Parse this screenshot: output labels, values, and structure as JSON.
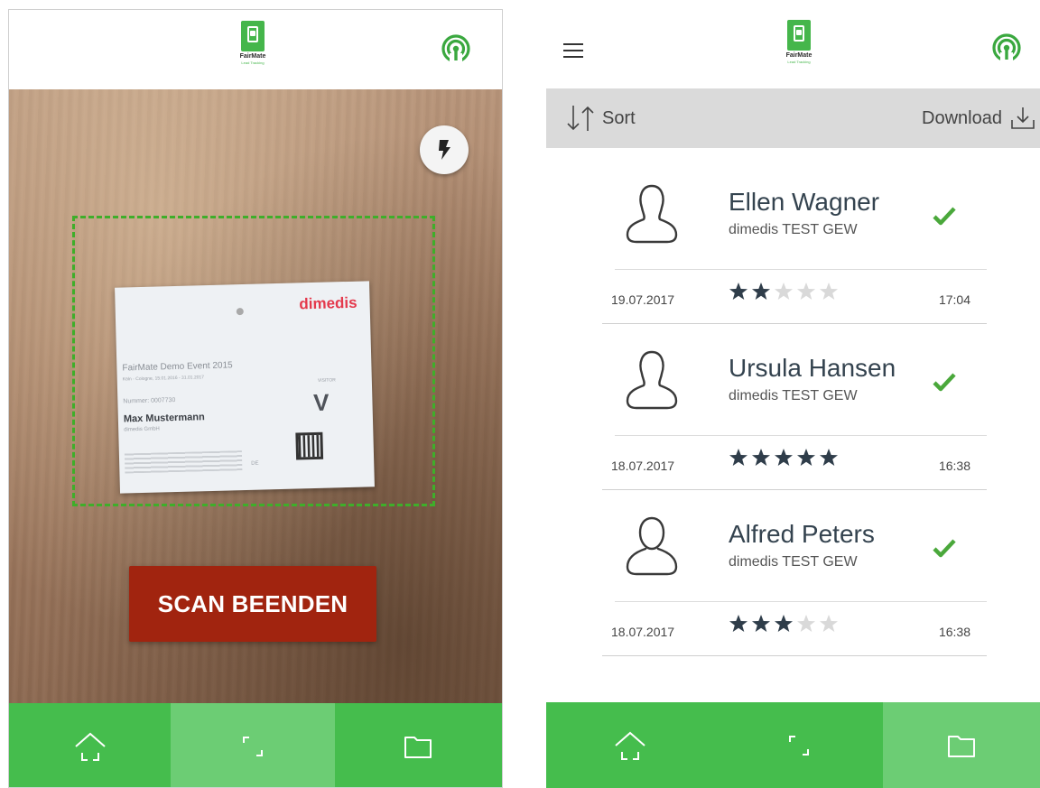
{
  "colors": {
    "brand_green": "#45bd4d",
    "active_nav": "#6ccd74",
    "scan_button": "#a1240f",
    "scan_frame": "#3fae2a",
    "check_green": "#4aa83b",
    "star_filled": "#2f3d4a",
    "star_empty": "#d9d9d9"
  },
  "logo": {
    "name": "FairMate",
    "tagline": "Lead Tracking"
  },
  "scanner": {
    "flash_icon": "flash-icon",
    "scan_end_label": "SCAN BEENDEN",
    "badge": {
      "brand": "dimedis",
      "event": "FairMate Demo Event 2015",
      "dates": "Köln - Cologne, 15.01.2016 - 31.01.2017",
      "nummer": "Nummer: 0007730",
      "visitor_tag": "VISITOR",
      "visitor_letter": "V",
      "person": "Max Mustermann",
      "company": "dimedis GmbH",
      "country": "DE"
    },
    "active_tab": "scan"
  },
  "leads": {
    "sort_label": "Sort",
    "download_label": "Download",
    "active_tab": "list",
    "items": [
      {
        "name": "Ellen Wagner",
        "company": "dimedis TEST GEW",
        "date": "19.07.2017",
        "time": "17:04",
        "rating": 2,
        "avatar": "female-avatar-icon"
      },
      {
        "name": "Ursula Hansen",
        "company": "dimedis TEST GEW",
        "date": "18.07.2017",
        "time": "16:38",
        "rating": 5,
        "avatar": "female-avatar-icon"
      },
      {
        "name": "Alfred Peters",
        "company": "dimedis TEST GEW",
        "date": "18.07.2017",
        "time": "16:38",
        "rating": 3,
        "avatar": "male-avatar-icon"
      }
    ]
  },
  "nav_icons": [
    "home-icon",
    "scan-icon",
    "folder-icon"
  ]
}
